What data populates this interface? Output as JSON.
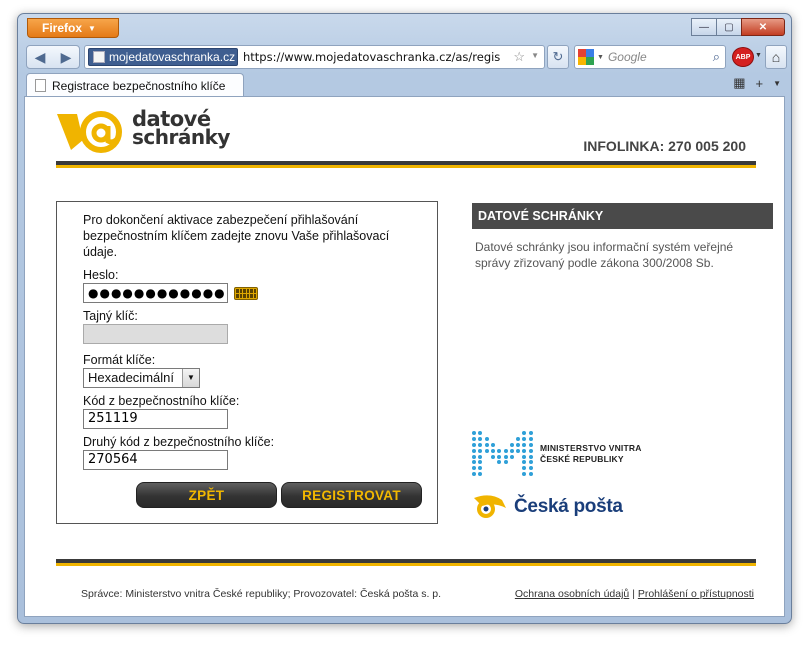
{
  "browser": {
    "app_button": "Firefox",
    "identity_label": "mojedatovaschranka.cz",
    "url": "https://www.mojedatovaschranka.cz/as/regis",
    "search_placeholder": "Google",
    "tab_title": "Registrace bezpečnostního klíče",
    "abp_label": "ABP"
  },
  "header": {
    "logo_line1": "datové",
    "logo_line2": "schránky",
    "infolinka": "INFOLINKA: 270 005 200"
  },
  "form": {
    "intro": "Pro dokončení aktivace zabezpečení přihlašování bezpečnostním klíčem zadejte znovu Vaše přihlašovací údaje.",
    "password_label": "Heslo:",
    "password_value": "●●●●●●●●●●●●",
    "secret_key_label": "Tajný klíč:",
    "format_label": "Formát klíče:",
    "format_value": "Hexadecimální",
    "code1_label": "Kód z bezpečnostního klíče:",
    "code1_value": "251119",
    "code2_label": "Druhý kód z bezpečnostního klíče:",
    "code2_value": "270564",
    "back_button": "ZPĚT",
    "register_button": "REGISTROVAT"
  },
  "sidebar": {
    "heading": "DATOVÉ SCHRÁNKY",
    "text": "Datové schránky jsou informační systém veřejné správy zřizovaný podle zákona 300/2008 Sb.",
    "mvcr_line1": "MINISTERSTVO VNITRA",
    "mvcr_line2": "ČESKÉ REPUBLIKY",
    "posta": "Česká pošta"
  },
  "footer": {
    "left": "Správce: Ministerstvo vnitra České republiky; Provozovatel: Česká pošta s. p.",
    "link1": "Ochrana osobních údajů",
    "separator": "|",
    "link2": "Prohlášení o přístupnosti"
  },
  "colors": {
    "accent_yellow": "#f0b400",
    "dark_bar": "#3a3a3a",
    "posta_blue": "#1a3e7a",
    "mvcr_blue": "#2fa0d8"
  }
}
